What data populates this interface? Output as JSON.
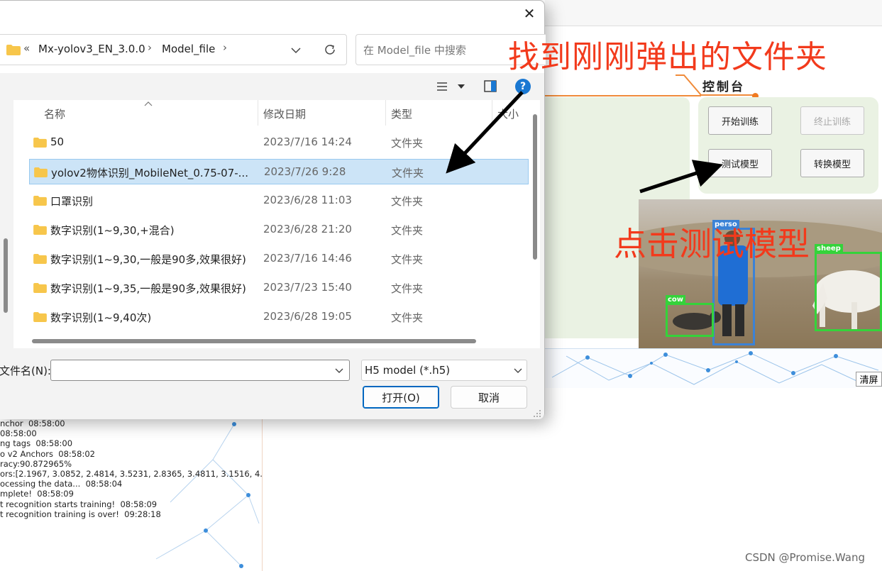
{
  "dialog": {
    "breadcrumb": [
      "Mx-yolov3_EN_3.0.0",
      "Model_file"
    ],
    "breadcrumb_prefix": "«",
    "search_placeholder": "在 Model_file 中搜索",
    "columns": {
      "name": "名称",
      "date": "修改日期",
      "type": "类型",
      "size": "大小"
    },
    "files": [
      {
        "name": "50",
        "date": "2023/7/16 14:24",
        "type": "文件夹",
        "selected": false
      },
      {
        "name": "yolov2物体识别_MobileNet_0.75-07-...",
        "date": "2023/7/26 9:28",
        "type": "文件夹",
        "selected": true
      },
      {
        "name": "口罩识别",
        "date": "2023/6/28 11:03",
        "type": "文件夹",
        "selected": false
      },
      {
        "name": "数字识别(1~9,30,+混合)",
        "date": "2023/6/28 21:20",
        "type": "文件夹",
        "selected": false
      },
      {
        "name": "数字识别(1~9,30,一般是90多,效果很好)",
        "date": "2023/7/16 14:46",
        "type": "文件夹",
        "selected": false
      },
      {
        "name": "数字识别(1~9,35,一般是90多,效果很好)",
        "date": "2023/7/23 15:40",
        "type": "文件夹",
        "selected": false
      },
      {
        "name": "数字识别(1~9,40次)",
        "date": "2023/6/28 19:05",
        "type": "文件夹",
        "selected": false
      }
    ],
    "filename_label": "文件名(N):",
    "filename_value": "",
    "filetype_value": "H5 model (*.h5)",
    "open_label": "打开(O)",
    "cancel_label": "取消"
  },
  "app": {
    "console_title": "控制台",
    "buttons": {
      "start_training": "开始训练",
      "stop_training": "终止训练",
      "test_model": "测试模型",
      "convert_model": "转换模型"
    },
    "clear_label": "清屏",
    "detections": [
      {
        "label": "person",
        "shown_label": "perso",
        "color": "#3b82d6"
      },
      {
        "label": "sheep",
        "shown_label": "sheep",
        "color": "#34d33a"
      },
      {
        "label": "cow",
        "shown_label": "cow",
        "color": "#34d33a"
      }
    ],
    "log": [
      "nchor  08:58:00",
      "08:58:00",
      "ng tags  08:58:00",
      "o v2 Anchors  08:58:02",
      "racy:90.872965%",
      "ors:[2.1967, 3.0852, 2.4814, 3.5231, 2.8365, 3.4811, 3.1516, 4.",
      "ocessing the data...  08:58:04",
      "mplete!  08:58:09",
      "t recognition starts training!  08:58:09",
      "t recognition training is over!  09:28:18"
    ]
  },
  "annotations": {
    "find_folder": "找到刚刚弹出的文件夹",
    "click_test": "点击测试模型",
    "annotation_color": "#f23a1c"
  },
  "watermark": "CSDN @Promise.Wang",
  "colors": {
    "selection": "#cce4f7",
    "accent": "#0067c0",
    "help": "#1a78d2",
    "orange": "#f08b3a"
  }
}
